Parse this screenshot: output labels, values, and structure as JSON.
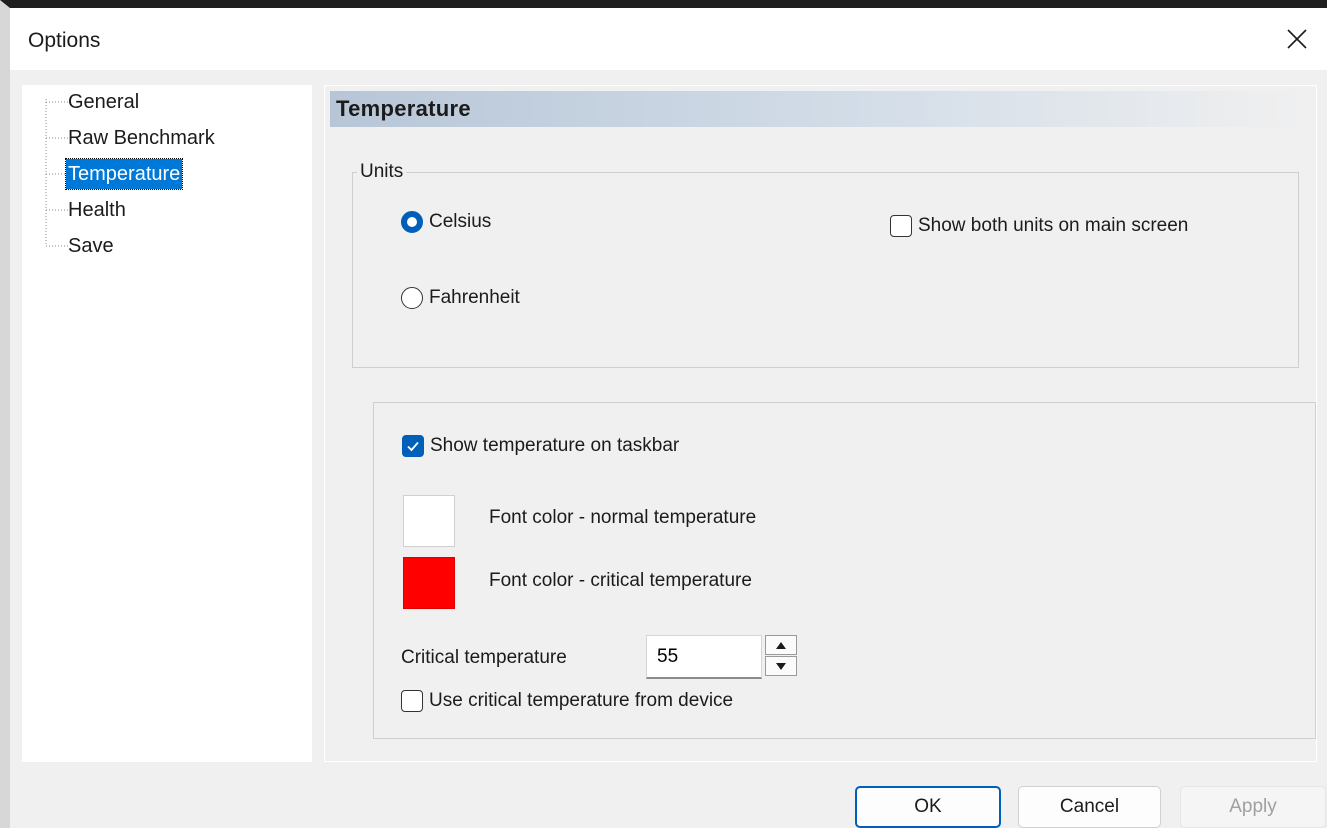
{
  "window": {
    "title": "Options"
  },
  "tree": {
    "items": [
      {
        "label": "General",
        "selected": false
      },
      {
        "label": "Raw Benchmark",
        "selected": false
      },
      {
        "label": "Temperature",
        "selected": true
      },
      {
        "label": "Health",
        "selected": false
      },
      {
        "label": "Save",
        "selected": false
      }
    ]
  },
  "panel": {
    "header": "Temperature",
    "units_group": {
      "legend": "Units",
      "celsius_label": "Celsius",
      "celsius_selected": true,
      "fahrenheit_label": "Fahrenheit",
      "fahrenheit_selected": false,
      "show_both_label": "Show both units on main screen",
      "show_both_checked": false
    },
    "taskbar_group": {
      "show_taskbar_label": "Show temperature on taskbar",
      "show_taskbar_checked": true,
      "normal_color_label": "Font color - normal temperature",
      "normal_color": "#ffffff",
      "critical_color_label": "Font color - critical temperature",
      "critical_color": "#ff0000",
      "critical_temp_label": "Critical temperature",
      "critical_temp_value": "55",
      "use_device_label": "Use critical temperature from device",
      "use_device_checked": false
    }
  },
  "buttons": {
    "ok": "OK",
    "cancel": "Cancel",
    "apply": "Apply"
  },
  "colors": {
    "accent": "#005fb8",
    "selection": "#0078d7"
  }
}
